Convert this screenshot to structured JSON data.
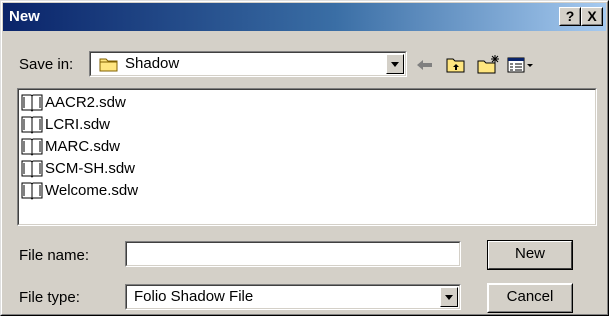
{
  "window": {
    "title": "New",
    "help_label": "?",
    "close_label": "X",
    "gradient_colors": [
      "#0a246a",
      "#a6caf0"
    ]
  },
  "save_in": {
    "label": "Save in:",
    "value": "Shadow",
    "icon": "folder-icon"
  },
  "toolbar": {
    "icons": [
      "back-arrow-icon",
      "up-folder-icon",
      "new-folder-icon",
      "view-menu-icon"
    ]
  },
  "files": [
    {
      "name": "AACR2.sdw",
      "icon": "book-icon"
    },
    {
      "name": "LCRI.sdw",
      "icon": "book-icon"
    },
    {
      "name": "MARC.sdw",
      "icon": "book-icon"
    },
    {
      "name": "SCM-SH.sdw",
      "icon": "book-icon"
    },
    {
      "name": "Welcome.sdw",
      "icon": "book-icon"
    }
  ],
  "file_name": {
    "label": "File name:",
    "value": ""
  },
  "file_type": {
    "label": "File type:",
    "value": "Folio Shadow File"
  },
  "buttons": {
    "new_label": "New",
    "cancel_label": "Cancel"
  }
}
